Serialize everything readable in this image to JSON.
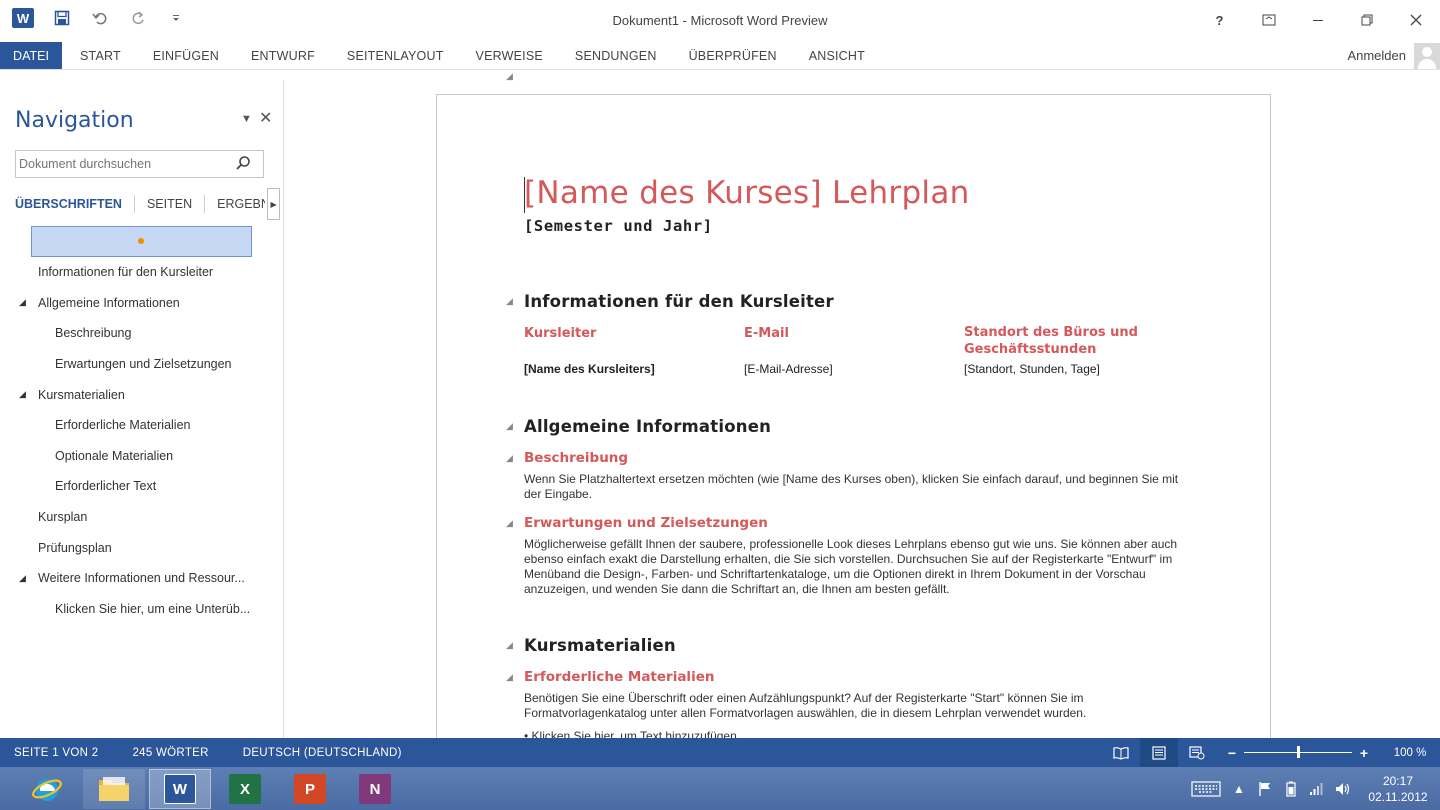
{
  "window": {
    "title": "Dokument1 - Microsoft Word Preview",
    "app_icon": "word-logo-icon",
    "controls": [
      "help-icon",
      "ribbon-display-icon",
      "minimize-icon",
      "restore-icon",
      "close-icon"
    ]
  },
  "quick_access": {
    "logo_letter": "W",
    "items": [
      "save-icon",
      "undo-icon",
      "redo-icon",
      "customize-icon"
    ]
  },
  "ribbon": {
    "file_tab": "DATEI",
    "tabs": [
      "START",
      "EINFÜGEN",
      "ENTWURF",
      "SEITENLAYOUT",
      "VERWEISE",
      "SENDUNGEN",
      "ÜBERPRÜFEN",
      "ANSICHT"
    ],
    "signin": "Anmelden"
  },
  "navigation": {
    "title": "Navigation",
    "search_placeholder": "Dokument durchsuchen",
    "tabs": [
      "ÜBERSCHRIFTEN",
      "SEITEN",
      "ERGEBNISSE"
    ],
    "items": [
      {
        "label": "Informationen für den Kursleiter",
        "level": 1,
        "collapsible": false
      },
      {
        "label": "Allgemeine Informationen",
        "level": 1,
        "collapsible": true
      },
      {
        "label": "Beschreibung",
        "level": 2,
        "collapsible": false
      },
      {
        "label": "Erwartungen und Zielsetzungen",
        "level": 2,
        "collapsible": false
      },
      {
        "label": "Kursmaterialien",
        "level": 1,
        "collapsible": true
      },
      {
        "label": "Erforderliche Materialien",
        "level": 2,
        "collapsible": false
      },
      {
        "label": "Optionale Materialien",
        "level": 2,
        "collapsible": false
      },
      {
        "label": "Erforderlicher Text",
        "level": 2,
        "collapsible": false
      },
      {
        "label": "Kursplan",
        "level": 1,
        "collapsible": false
      },
      {
        "label": "Prüfungsplan",
        "level": 1,
        "collapsible": false
      },
      {
        "label": "Weitere Informationen und Ressour...",
        "level": 1,
        "collapsible": true
      },
      {
        "label": "Klicken Sie hier, um eine Unterüb...",
        "level": 2,
        "collapsible": false
      }
    ]
  },
  "document": {
    "title": "[Name des Kurses] Lehrplan",
    "subtitle": "[Semester und Jahr]",
    "instructor_heading": "Informationen für den Kursleiter",
    "table": {
      "headers": [
        "Kursleiter",
        "E-Mail",
        "Standort des Büros und Geschäftsstunden"
      ],
      "row": [
        "[Name des Kursleiters]",
        "[E-Mail-Adresse]",
        "[Standort, Stunden, Tage]"
      ]
    },
    "general_heading": "Allgemeine Informationen",
    "description_heading": "Beschreibung",
    "description_text": "Wenn Sie Platzhaltertext ersetzen möchten (wie [Name des Kurses oben), klicken Sie einfach darauf, und beginnen Sie mit der Eingabe.",
    "expectations_heading": "Erwartungen und Zielsetzungen",
    "expectations_text": "Möglicherweise gefällt Ihnen der saubere, professionelle Look dieses Lehrplans ebenso gut wie uns. Sie können aber auch ebenso einfach exakt die Darstellung erhalten, die Sie sich vorstellen. Durchsuchen Sie auf der Registerkarte \"Entwurf\" im Menüband die Design-, Farben- und Schriftartenkataloge, um die Optionen direkt in Ihrem Dokument in der Vorschau anzuzeigen, und wenden Sie dann die Schriftart an, die Ihnen am besten gefällt.",
    "materials_heading": "Kursmaterialien",
    "required_materials_heading": "Erforderliche Materialien",
    "required_materials_text": "Benötigen Sie eine Überschrift oder einen Aufzählungspunkt? Auf der Registerkarte \"Start\" können Sie im Formatvorlagenkatalog unter allen Formatvorlagen auswählen, die in diesem Lehrplan verwendet wurden.",
    "bullet_text": "• Klicken Sie hier, um Text hinzuzufügen."
  },
  "statusbar": {
    "page": "SEITE 1 VON 2",
    "words": "245 WÖRTER",
    "language": "DEUTSCH (DEUTSCHLAND)",
    "zoom_percent": "100 %",
    "zoom_fraction": 0.5
  },
  "taskbar": {
    "apps": [
      "internet-explorer-icon",
      "file-explorer-icon",
      "word-icon",
      "excel-icon",
      "powerpoint-icon",
      "onenote-icon"
    ],
    "app_letters": {
      "word": "W",
      "excel": "X",
      "powerpoint": "P",
      "onenote": "N"
    },
    "tray": [
      "keyboard-icon",
      "show-hidden-icon",
      "flag-icon",
      "battery-icon",
      "network-icon",
      "volume-icon"
    ],
    "time": "20:17",
    "date": "02.11.2012"
  },
  "colors": {
    "brand": "#2b579a",
    "heading_red": "#d5595a",
    "selection": "#c5d7f2"
  }
}
